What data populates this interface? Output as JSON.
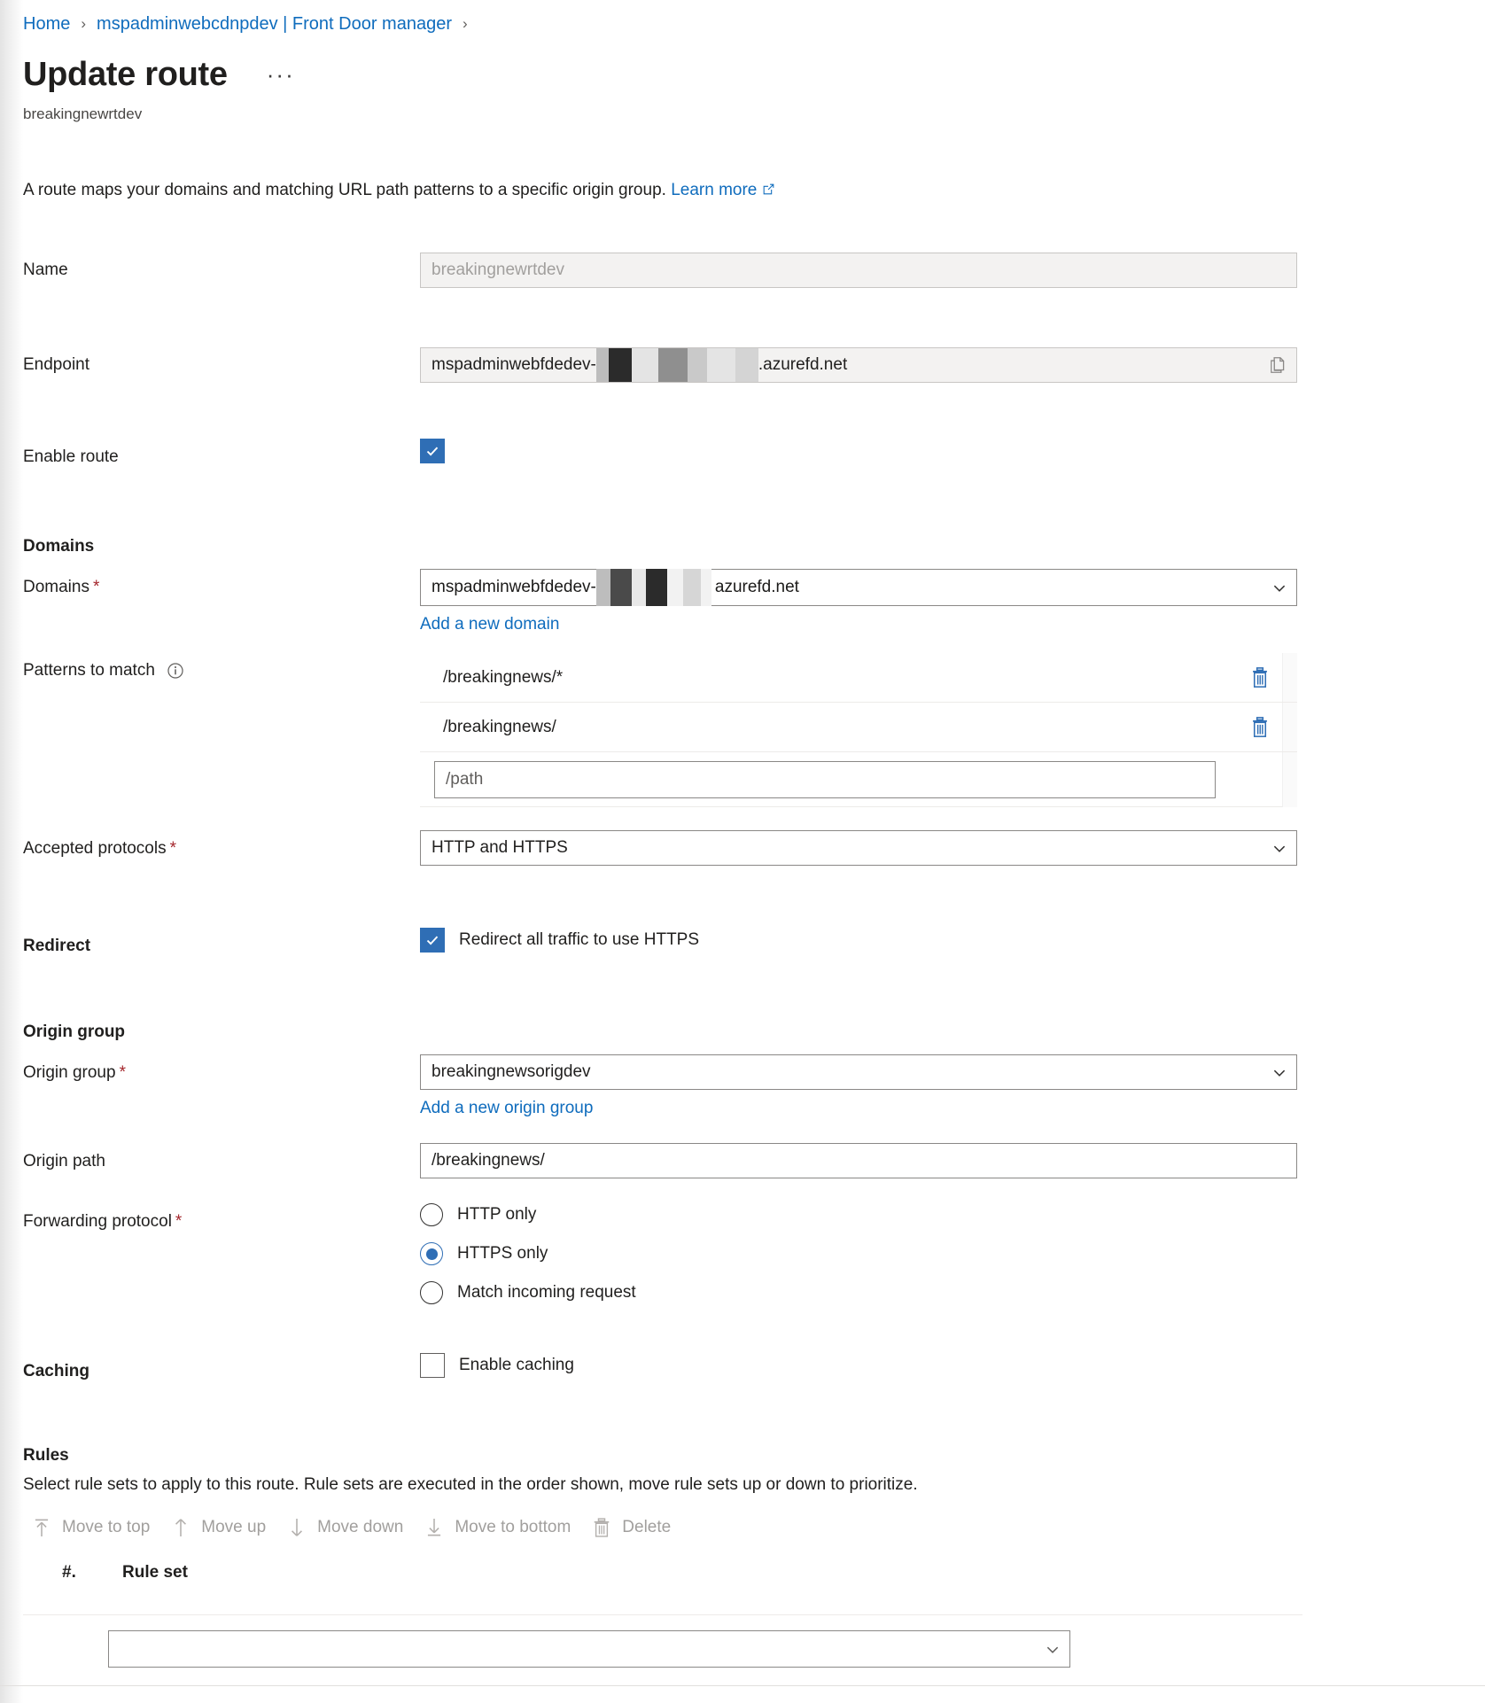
{
  "breadcrumb": {
    "items": [
      "Home",
      "mspadminwebcdnpdev | Front Door manager"
    ],
    "separator": "›"
  },
  "header": {
    "title": "Update route",
    "ellipsis": "···",
    "subtitle": "breakingnewrtdev"
  },
  "description": {
    "text": "A route maps your domains and matching URL path patterns to a specific origin group.",
    "link_label": "Learn more",
    "link_icon": "external-link-icon"
  },
  "form": {
    "name": {
      "label": "Name",
      "value": "breakingnewrtdev",
      "disabled": true
    },
    "endpoint": {
      "label": "Endpoint",
      "prefix": "mspadminwebfdedev-",
      "suffix": ".azurefd.net",
      "redacted": true,
      "copy_icon": "copy-icon",
      "disabled": true
    },
    "enable_route": {
      "label": "Enable route",
      "checked": true
    },
    "domains_section": {
      "heading": "Domains",
      "label": "Domains",
      "required": "*",
      "prefix": "mspadminwebfdedev-",
      "suffix": "azurefd.net",
      "redacted": true,
      "add_link": "Add a new domain"
    },
    "patterns": {
      "label": "Patterns to match",
      "info_icon": "info-icon",
      "rows": [
        "/breakingnews/*",
        "/breakingnews/"
      ],
      "new_placeholder": "/path",
      "new_value": "",
      "delete_icon": "trash-icon"
    },
    "accepted_protocols": {
      "label": "Accepted protocols",
      "required": "*",
      "value": "HTTP and HTTPS"
    },
    "redirect": {
      "label": "Redirect",
      "checkbox_label": "Redirect all traffic to use HTTPS",
      "checked": true
    },
    "origin_group_section": {
      "heading": "Origin group",
      "label": "Origin group",
      "required": "*",
      "value": "breakingnewsorigdev",
      "add_link": "Add a new origin group"
    },
    "origin_path": {
      "label": "Origin path",
      "value": "/breakingnews/"
    },
    "forwarding_protocol": {
      "label": "Forwarding protocol",
      "required": "*",
      "options": [
        "HTTP only",
        "HTTPS only",
        "Match incoming request"
      ],
      "selected": "HTTPS only"
    },
    "caching": {
      "label": "Caching",
      "checkbox_label": "Enable caching",
      "checked": false
    }
  },
  "rules": {
    "heading": "Rules",
    "description": "Select rule sets to apply to this route. Rule sets are executed in the order shown, move rule sets up or down to prioritize.",
    "commands": [
      {
        "label": "Move to top",
        "icon": "move-to-top-icon",
        "disabled": true
      },
      {
        "label": "Move up",
        "icon": "arrow-up-icon",
        "disabled": true
      },
      {
        "label": "Move down",
        "icon": "arrow-down-icon",
        "disabled": true
      },
      {
        "label": "Move to bottom",
        "icon": "move-to-bottom-icon",
        "disabled": true
      },
      {
        "label": "Delete",
        "icon": "trash-icon",
        "disabled": true
      }
    ],
    "columns": [
      "#.",
      "Rule set"
    ],
    "row_select_value": ""
  },
  "colors": {
    "link": "#0f6cbd",
    "accent": "#2f6eb5",
    "required": "#a4262c",
    "border": "#8a8886",
    "disabled_bg": "#f3f2f1"
  }
}
